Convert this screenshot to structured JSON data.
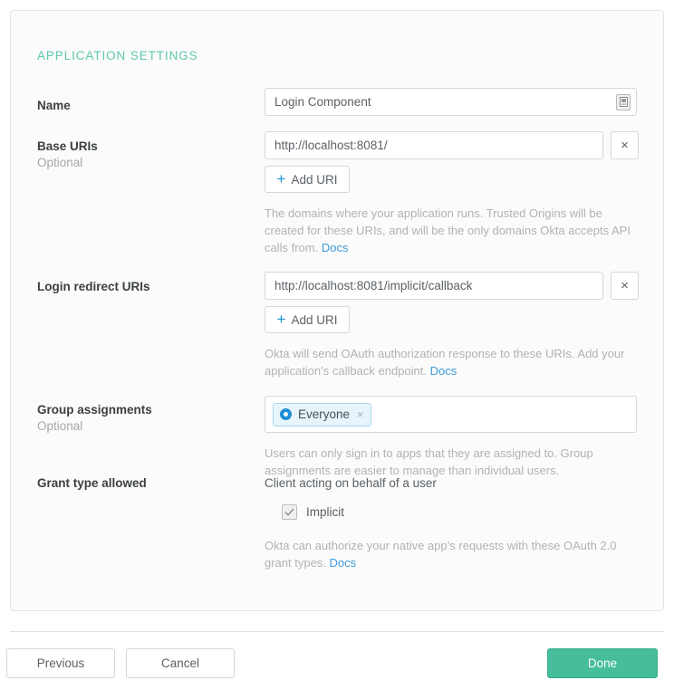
{
  "card": {
    "section_title": "APPLICATION SETTINGS"
  },
  "fields": {
    "name": {
      "label": "Name",
      "value": "Login Component",
      "icon": "image-placeholder-icon"
    },
    "base_uris": {
      "label": "Base URIs",
      "sublabel": "Optional",
      "value": "http://localhost:8081/",
      "remove_label": "×",
      "add_label": "Add URI",
      "add_icon": "plus-icon",
      "help": "The domains where your application runs. Trusted Origins will be created for these URIs, and will be the only domains Okta accepts API calls from. ",
      "docs_label": "Docs"
    },
    "login_redirect_uris": {
      "label": "Login redirect URIs",
      "value": "http://localhost:8081/implicit/callback",
      "remove_label": "×",
      "add_label": "Add URI",
      "add_icon": "plus-icon",
      "help": "Okta will send OAuth authorization response to these URIs. Add your application’s callback endpoint. ",
      "docs_label": "Docs"
    },
    "group_assignments": {
      "label": "Group assignments",
      "sublabel": "Optional",
      "chip_label": "Everyone",
      "chip_icon": "group-ring-icon",
      "chip_remove_label": "×",
      "help": "Users can only sign in to apps that they are assigned to. Group assignments are easier to manage than individual users."
    },
    "grant_type": {
      "label": "Grant type allowed",
      "heading": "Client acting on behalf of a user",
      "checkbox_label": "Implicit",
      "checkbox_checked": true,
      "help": "Okta can authorize your native app’s requests with these OAuth 2.0 grant types. ",
      "docs_label": "Docs"
    }
  },
  "footer": {
    "previous_label": "Previous",
    "cancel_label": "Cancel",
    "done_label": "Done"
  },
  "colors": {
    "section_title": "#5ec8b0",
    "link": "#3d9ad9",
    "primary_button": "#46bd9b",
    "chip_border": "#a8d5ee",
    "chip_background": "#e8f4fb",
    "accent_blue": "#1692d4"
  }
}
